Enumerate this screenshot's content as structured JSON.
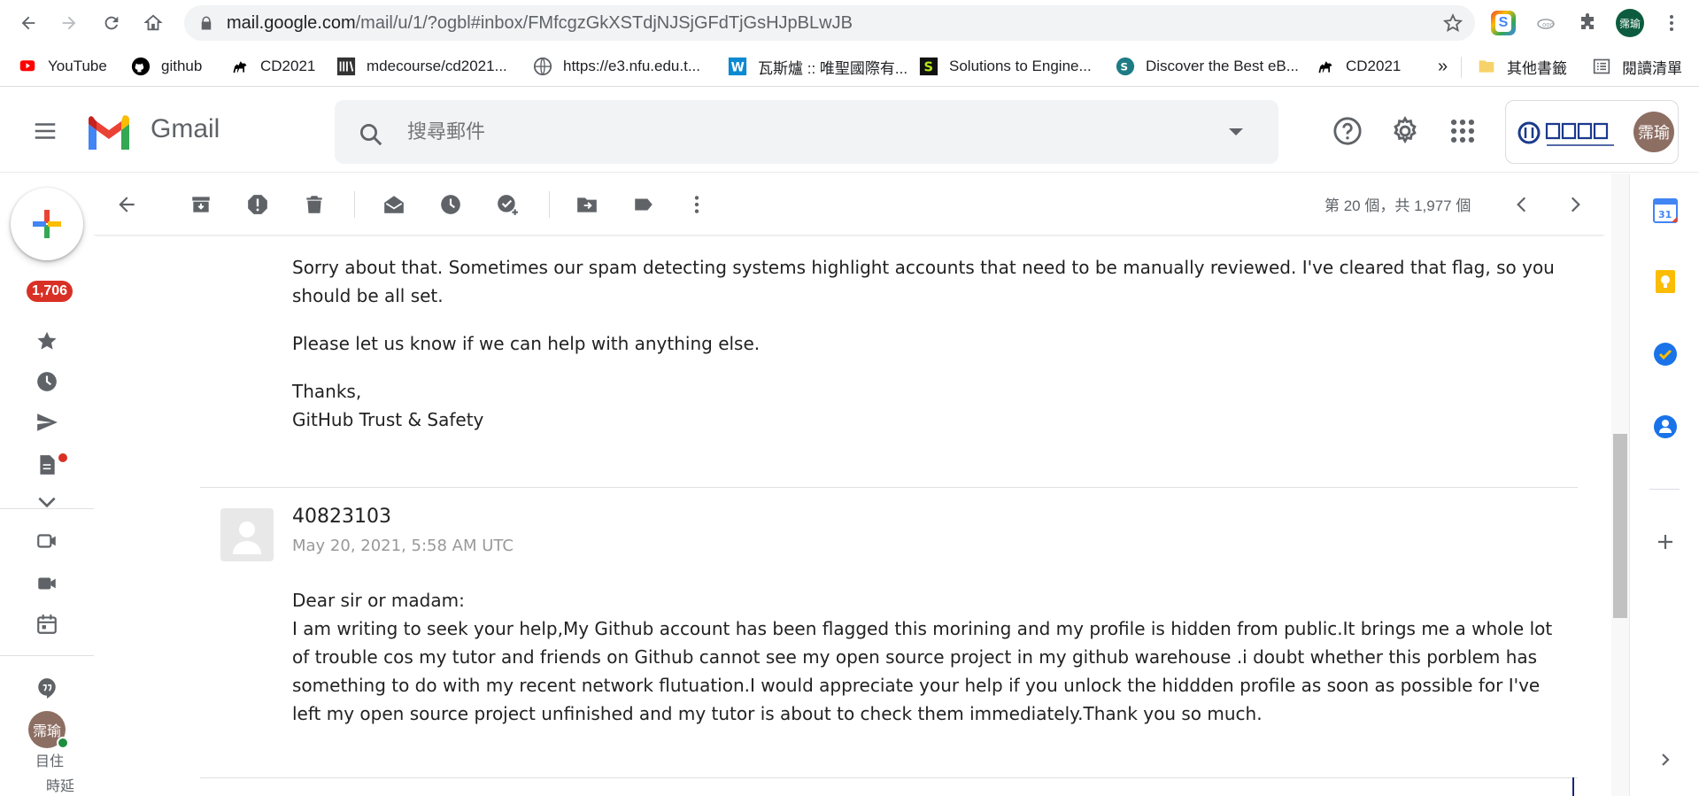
{
  "browser": {
    "url_host": "mail.google.com",
    "url_path": "/mail/u/1/?ogbl#inbox/FMfcgzGkXSTdjNJSjGFdTjGsHJpBLwJB",
    "profile_chip": "霈瑜"
  },
  "bookmarks": [
    {
      "label": "YouTube",
      "icon": "youtube-icon"
    },
    {
      "label": "github",
      "icon": "github-icon"
    },
    {
      "label": "CD2021",
      "icon": "camel-icon"
    },
    {
      "label": "mdecourse/cd2021...",
      "icon": "mde-icon"
    },
    {
      "label": "https://e3.nfu.edu.t...",
      "icon": "globe-icon"
    },
    {
      "label": "瓦斯爐 :: 唯聖國際有...",
      "icon": "w-icon"
    },
    {
      "label": "Solutions to Engine...",
      "icon": "s-icon"
    },
    {
      "label": "Discover the Best eB...",
      "icon": "scribd-icon"
    },
    {
      "label": "CD2021",
      "icon": "camel-icon"
    }
  ],
  "bookmarks_overflow": "»",
  "bookmarks_other": "其他書籤",
  "bookmarks_reading_list": "閱讀清單",
  "gmail": {
    "brand": "Gmail",
    "search_placeholder": "搜尋郵件",
    "org_avatar": "霈瑜",
    "user_avatar": "霈瑜"
  },
  "rail": {
    "inbox_count": "1,706",
    "caption_line1": "目住",
    "caption_line2": "時延"
  },
  "toolbar": {
    "paging": "第 20 個，共 1,977 個"
  },
  "messages": [
    {
      "body_lines": [
        "Sorry about that. Sometimes our spam detecting systems highlight accounts that need to be manually reviewed. I've cleared that flag, so you",
        "should be all set."
      ],
      "para2": "Please let us know if we can help with anything else.",
      "sign1": "Thanks,",
      "sign2": "GitHub Trust & Safety"
    },
    {
      "sender": "40823103",
      "date": "May 20, 2021, 5:58 AM UTC",
      "greeting": "Dear sir or madam:",
      "body_lines": [
        "I am writing to seek your help,My Github account has been flagged this morining and my profile is hidden from public.It brings me a whole lot",
        "of trouble cos my tutor and friends on Github cannot see my open source project in my github warehouse .i doubt whether this porblem has",
        "something to do with my recent network flutuation.I would appreciate your help if you unlock the hiddden profile as soon as possible for I've",
        "left my open source project unfinished and my tutor is about to check them immediately.Thank you so much."
      ]
    }
  ],
  "colors": {
    "badge_red": "#d93025",
    "gmail_red": "#ea4335",
    "online_green": "#1e8e3e"
  }
}
